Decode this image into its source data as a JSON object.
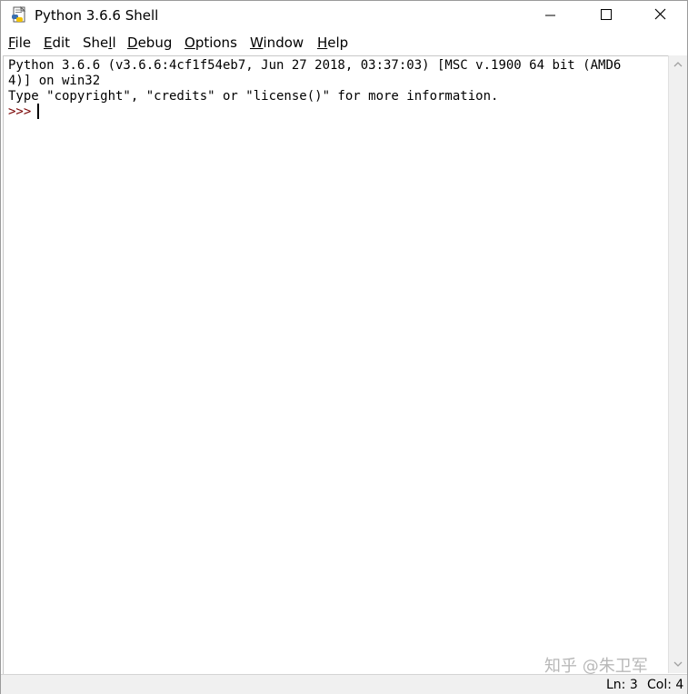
{
  "window": {
    "title": "Python 3.6.6 Shell",
    "icon": "python-idle-icon"
  },
  "menu": {
    "items": [
      {
        "label": "File",
        "access_key": "F",
        "rest": "ile"
      },
      {
        "label": "Edit",
        "access_key": "E",
        "rest": "dit"
      },
      {
        "label": "Shell",
        "access_key": "",
        "prefix": "She",
        "mid": "l",
        "suffix": "l"
      },
      {
        "label": "Debug",
        "access_key": "D",
        "rest": "ebug"
      },
      {
        "label": "Options",
        "access_key": "O",
        "rest": "ptions"
      },
      {
        "label": "Window",
        "access_key": "W",
        "rest": "indow"
      },
      {
        "label": "Help",
        "access_key": "H",
        "rest": "elp"
      }
    ]
  },
  "shell": {
    "output": "Python 3.6.6 (v3.6.6:4cf1f54eb7, Jun 27 2018, 03:37:03) [MSC v.1900 64 bit (AMD6\n4)] on win32\nType \"copyright\", \"credits\" or \"license()\" for more information.",
    "prompt": ">>> "
  },
  "status": {
    "line": "Ln: 3",
    "col": "Col: 4"
  },
  "watermark": "知乎 @朱卫军",
  "colors": {
    "prompt": "#770000",
    "statusbar_bg": "#f0f0f0"
  }
}
